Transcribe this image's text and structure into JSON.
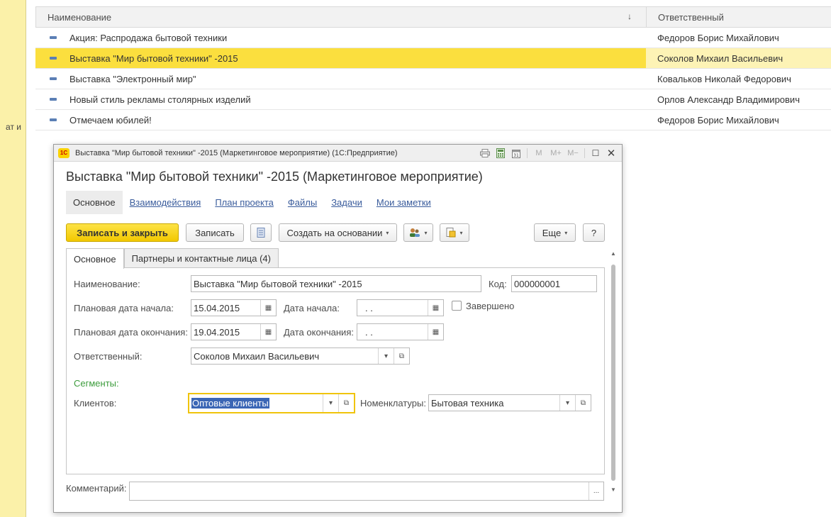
{
  "left_panel": {
    "clipped_text": "ат и"
  },
  "list": {
    "columns": {
      "name": "Наименование",
      "responsible": "Ответственный",
      "sort_icon": "↓"
    },
    "rows": [
      {
        "name": "Акция: Распродажа бытовой техники",
        "responsible": "Федоров Борис Михайлович"
      },
      {
        "name": "Выставка \"Мир бытовой техники\" -2015",
        "responsible": "Соколов Михаил Васильевич"
      },
      {
        "name": "Выставка \"Электронный мир\"",
        "responsible": "Ковальков Николай Федорович"
      },
      {
        "name": "Новый стиль рекламы столярных изделий",
        "responsible": "Орлов Александр Владимирович"
      },
      {
        "name": "Отмечаем юбилей!",
        "responsible": "Федоров Борис Михайлович"
      }
    ],
    "selected_index": 1
  },
  "window": {
    "title": "Выставка \"Мир бытовой техники\" -2015 (Маркетинговое мероприятие)  (1С:Предприятие)",
    "logo": "1С",
    "titlebar": {
      "m": "M",
      "m_plus": "M+",
      "m_minus": "M−",
      "maximize": "☐",
      "close": "✕"
    }
  },
  "form": {
    "heading": "Выставка \"Мир бытовой техники\" -2015 (Маркетинговое мероприятие)",
    "nav": [
      "Основное",
      "Взаимодействия",
      "План проекта",
      "Файлы",
      "Задачи",
      "Мои заметки"
    ],
    "toolbar": {
      "save_close": "Записать и закрыть",
      "save": "Записать",
      "create_based_on": "Создать на основании",
      "more": "Еще",
      "help": "?"
    },
    "tabs": [
      "Основное",
      "Партнеры и контактные лица (4)"
    ],
    "fields": {
      "name_label": "Наименование:",
      "name_value": "Выставка \"Мир бытовой техники\" -2015",
      "code_label": "Код:",
      "code_value": "000000001",
      "plan_start_label": "Плановая дата начала:",
      "plan_start_value": "15.04.2015",
      "start_label": "Дата начала:",
      "start_value": " .  .",
      "completed_label": "Завершено",
      "plan_end_label": "Плановая дата окончания:",
      "plan_end_value": "19.04.2015",
      "end_label": "Дата окончания:",
      "end_value": " .  .",
      "responsible_label": "Ответственный:",
      "responsible_value": "Соколов Михаил Васильевич",
      "segments_label": "Сегменты:",
      "clients_label": "Клиентов:",
      "clients_value": "Оптовые клиенты",
      "nomenclature_label": "Номенклатуры:",
      "nomenclature_value": "Бытовая техника",
      "comment_label": "Комментарий:",
      "comment_value": ""
    },
    "glyphs": {
      "dropdown": "▾",
      "open": "⧉",
      "calendar": "▦",
      "ellipsis": "..."
    }
  }
}
